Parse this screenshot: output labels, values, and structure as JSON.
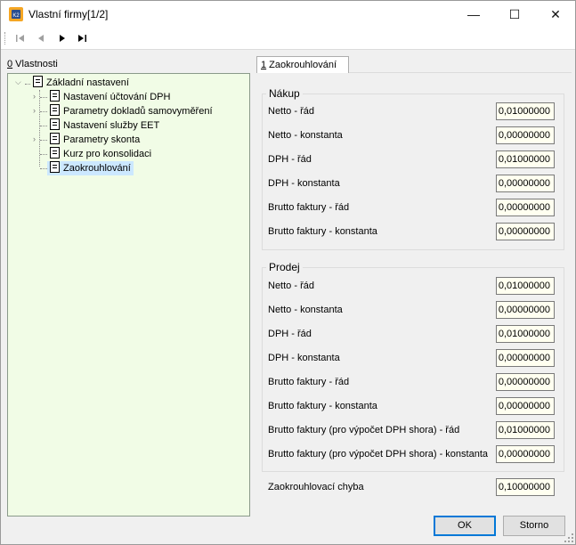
{
  "window": {
    "title": "Vlastní firmy[1/2]",
    "icon": "k2-app-icon"
  },
  "titlebar_buttons": {
    "minimize": "—",
    "maximize": "☐",
    "close": "✕"
  },
  "nav": {
    "first": "⏮",
    "prev": "◀",
    "next": "▶",
    "last": "⏭"
  },
  "left_panel": {
    "header_key": "0",
    "header_text": " Vlastnosti"
  },
  "tree": {
    "root": "Základní nastavení",
    "items": [
      {
        "label": "Nastavení účtování DPH",
        "expandable": true
      },
      {
        "label": "Parametry dokladů samovyměření",
        "expandable": true
      },
      {
        "label": "Nastavení služby EET",
        "expandable": false
      },
      {
        "label": "Parametry skonta",
        "expandable": true
      },
      {
        "label": "Kurz pro konsolidaci",
        "expandable": false
      },
      {
        "label": "Zaokrouhlování",
        "expandable": false,
        "selected": true
      }
    ]
  },
  "tab": {
    "key": "1",
    "text": " Zaokrouhlování"
  },
  "nakup": {
    "title": "Nákup",
    "rows": [
      {
        "label": "Netto - řád",
        "value": "0,01000000"
      },
      {
        "label": "Netto - konstanta",
        "value": "0,00000000"
      },
      {
        "label": "DPH - řád",
        "value": "0,01000000"
      },
      {
        "label": "DPH - konstanta",
        "value": "0,00000000"
      },
      {
        "label": "Brutto faktury - řád",
        "value": "0,00000000"
      },
      {
        "label": "Brutto faktury - konstanta",
        "value": "0,00000000"
      }
    ]
  },
  "prodej": {
    "title": "Prodej",
    "rows": [
      {
        "label": "Netto - řád",
        "value": "0,01000000"
      },
      {
        "label": "Netto - konstanta",
        "value": "0,00000000"
      },
      {
        "label": "DPH - řád",
        "value": "0,01000000"
      },
      {
        "label": "DPH - konstanta",
        "value": "0,00000000"
      },
      {
        "label": "Brutto faktury - řád",
        "value": "0,00000000"
      },
      {
        "label": "Brutto faktury - konstanta",
        "value": "0,00000000"
      },
      {
        "label": "Brutto faktury (pro výpočet DPH shora) - řád",
        "value": "0,01000000"
      },
      {
        "label": "Brutto faktury (pro výpočet DPH shora) - konstanta",
        "value": "0,00000000"
      }
    ]
  },
  "rounding_error": {
    "label": "Zaokrouhlovací chyba",
    "value": "0,10000000"
  },
  "buttons": {
    "ok": "OK",
    "cancel": "Storno"
  },
  "colors": {
    "tree_bg": "#f1fce6",
    "field_bg": "#fffff0",
    "selection": "#cce8ff",
    "accent": "#0078d7"
  }
}
